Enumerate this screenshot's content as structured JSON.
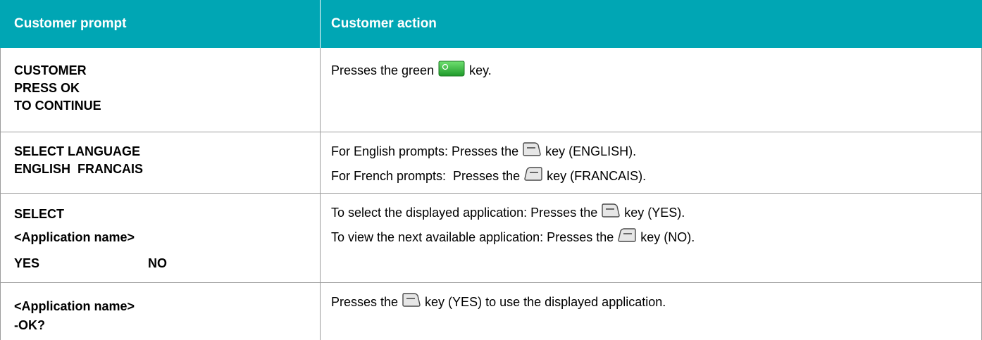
{
  "header": {
    "col1": "Customer prompt",
    "col2": "Customer action"
  },
  "rows": [
    {
      "prompt_lines": [
        "CUSTOMER",
        "PRESS OK",
        "TO CONTINUE"
      ],
      "actions": [
        {
          "before": "Presses the green",
          "key_icon": "green-ok-key-icon",
          "after": "key."
        }
      ]
    },
    {
      "prompt_lines": [
        "SELECT LANGUAGE",
        "ENGLISH  FRANCAIS"
      ],
      "actions": [
        {
          "before": "For English prompts: Presses the",
          "key_icon": "left-softkey-icon",
          "after": "key (ENGLISH)."
        },
        {
          "before": "For French prompts:  Presses the",
          "key_icon": "right-softkey-icon",
          "after": "key (FRANCAIS)."
        }
      ]
    },
    {
      "prompt_lines": [
        "SELECT",
        "<Application name>"
      ],
      "prompt_yes": "YES",
      "prompt_no": "NO",
      "actions": [
        {
          "before": "To select the displayed application: Presses the",
          "key_icon": "left-softkey-icon",
          "after": "key (YES)."
        },
        {
          "before": "To view the next available application: Presses the",
          "key_icon": "right-softkey-icon",
          "after": "key (NO)."
        }
      ]
    },
    {
      "prompt_lines": [
        "<Application name>",
        "-OK?"
      ],
      "actions": [
        {
          "before": "Presses the",
          "key_icon": "left-softkey-icon",
          "after": "key (YES) to use the displayed application."
        }
      ]
    }
  ],
  "colors": {
    "header_bg": "#00a6b4",
    "header_text": "#ffffff",
    "border": "#9c9c9c",
    "ok_key": "#2fbf3a"
  }
}
